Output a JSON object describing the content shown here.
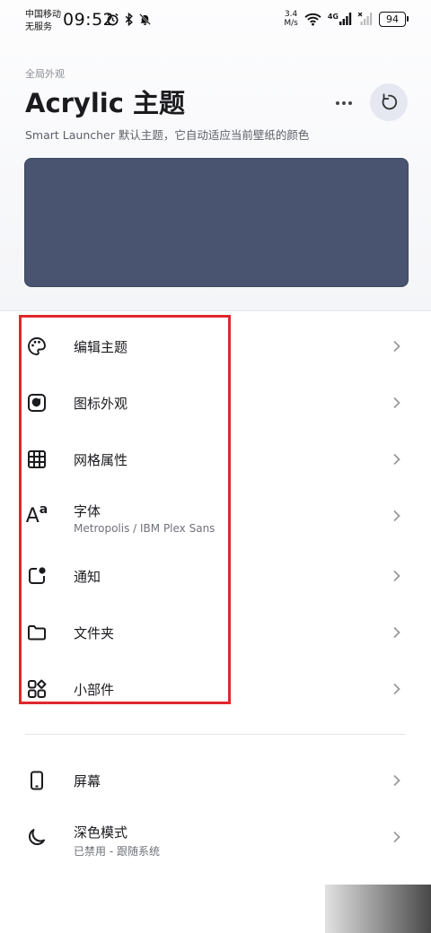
{
  "status_bar": {
    "carrier_line1": "中国移动",
    "carrier_line2": "无服务",
    "time": "09:52",
    "net_speed_value": "3.4",
    "net_speed_unit": "M/s",
    "network_type": "4G",
    "battery": "94"
  },
  "header": {
    "eyebrow": "全局外观",
    "title": "Acrylic 主题",
    "subtitle": "Smart Launcher 默认主题，它自动适应当前壁纸的颜色"
  },
  "settings": {
    "items": [
      {
        "label": "编辑主题",
        "icon": "palette-icon"
      },
      {
        "label": "图标外观",
        "icon": "icon-shape-icon"
      },
      {
        "label": "网格属性",
        "icon": "grid-icon"
      },
      {
        "label": "字体",
        "sublabel": "Metropolis / IBM Plex Sans",
        "icon": "font-icon"
      },
      {
        "label": "通知",
        "icon": "notification-dot-icon"
      },
      {
        "label": "文件夹",
        "icon": "folder-icon"
      },
      {
        "label": "小部件",
        "icon": "widgets-icon"
      },
      {
        "label": "屏幕",
        "icon": "phone-icon"
      },
      {
        "label": "深色模式",
        "sublabel": "已禁用 - 跟随系统",
        "icon": "moon-icon"
      }
    ]
  },
  "colors": {
    "preview": "#485470",
    "highlight": "#e0272d",
    "reset_button_bg": "#e5e8f1"
  }
}
